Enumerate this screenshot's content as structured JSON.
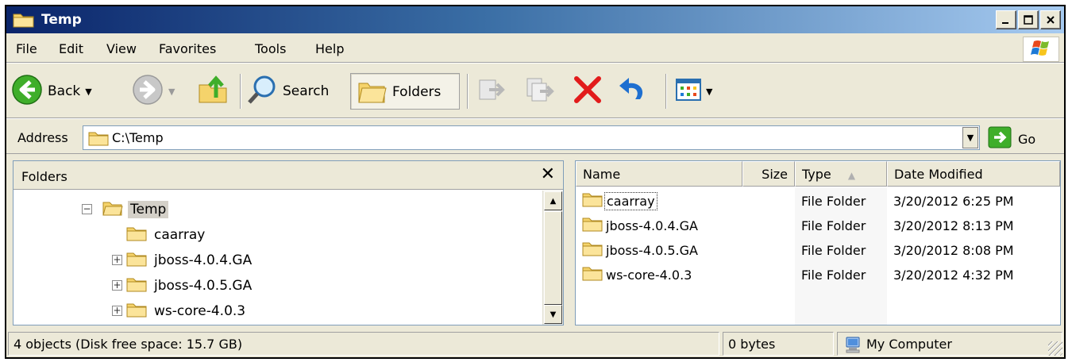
{
  "window": {
    "title": "Temp"
  },
  "menu": [
    "File",
    "Edit",
    "View",
    "Favorites",
    "Tools",
    "Help"
  ],
  "toolbar": {
    "back_label": "Back",
    "search_label": "Search",
    "folders_label": "Folders"
  },
  "address": {
    "label": "Address",
    "value": "C:\\Temp",
    "go_label": "Go"
  },
  "folders_pane": {
    "title": "Folders",
    "close_glyph": "✕",
    "tree": [
      {
        "label": "Temp",
        "expander": "−"
      },
      {
        "label": "caarray",
        "expander": ""
      },
      {
        "label": "jboss-4.0.4.GA",
        "expander": "+"
      },
      {
        "label": "jboss-4.0.5.GA",
        "expander": "+"
      },
      {
        "label": "ws-core-4.0.3",
        "expander": "+"
      }
    ]
  },
  "list": {
    "columns": [
      "Name",
      "Size",
      "Type",
      "Date Modified"
    ],
    "sort_indicator": "▲",
    "rows": [
      {
        "name": "caarray",
        "size": "",
        "type": "File Folder",
        "modified": "3/20/2012 6:25 PM"
      },
      {
        "name": "jboss-4.0.4.GA",
        "size": "",
        "type": "File Folder",
        "modified": "3/20/2012 8:13 PM"
      },
      {
        "name": "jboss-4.0.5.GA",
        "size": "",
        "type": "File Folder",
        "modified": "3/20/2012 8:08 PM"
      },
      {
        "name": "ws-core-4.0.3",
        "size": "",
        "type": "File Folder",
        "modified": "3/20/2012 4:32 PM"
      }
    ]
  },
  "status": {
    "objects": "4 objects (Disk free space: 15.7 GB)",
    "size": "0 bytes",
    "zone": "My Computer"
  },
  "colors": {
    "title_gradient_start": "#0a246a",
    "title_gradient_end": "#a6caf0",
    "folder_yellow": "#f5d36b",
    "delete_red": "#e21b1b",
    "go_green": "#3fae2a"
  },
  "icons": {
    "title": "folder-icon",
    "back": "back-arrow-icon",
    "forward": "forward-arrow-icon",
    "up": "up-folder-icon",
    "search": "search-magnifier-icon",
    "folders": "folders-icon",
    "move_to": "move-to-icon",
    "copy_to": "copy-to-icon",
    "delete": "delete-x-icon",
    "undo": "undo-icon",
    "views": "views-icon",
    "go": "go-arrow-icon",
    "my_computer": "my-computer-icon",
    "windows_logo": "windows-logo-icon"
  }
}
